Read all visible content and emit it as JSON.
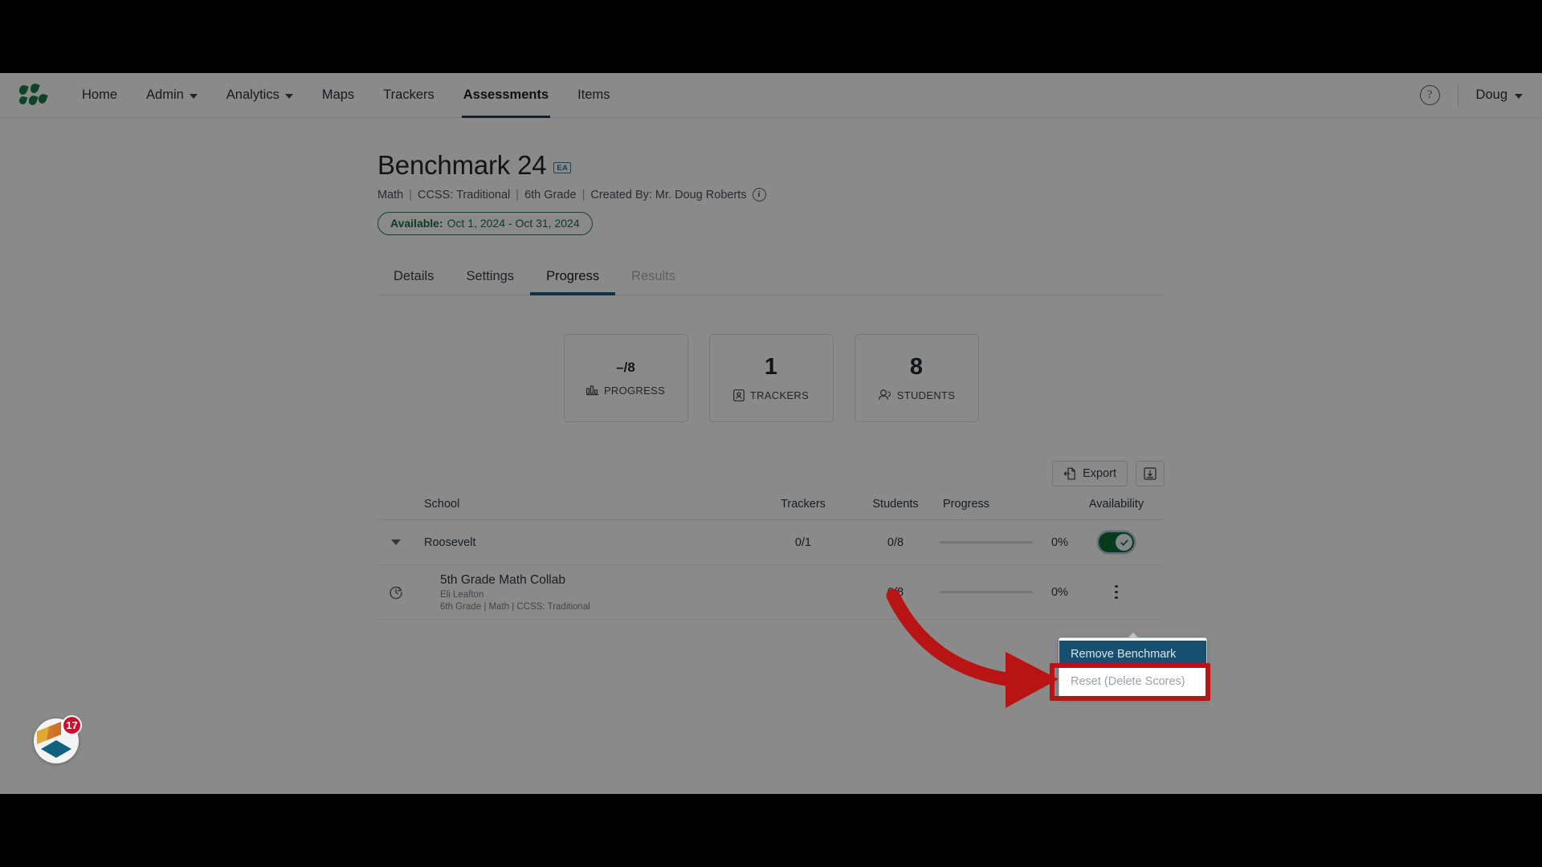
{
  "nav": {
    "logo_icon": "illuminate-leaf-logo",
    "links": [
      {
        "label": "Home",
        "has_caret": false,
        "active": false
      },
      {
        "label": "Admin",
        "has_caret": true,
        "active": false
      },
      {
        "label": "Analytics",
        "has_caret": true,
        "active": false
      },
      {
        "label": "Maps",
        "has_caret": false,
        "active": false
      },
      {
        "label": "Trackers",
        "has_caret": false,
        "active": false
      },
      {
        "label": "Assessments",
        "has_caret": false,
        "active": true
      },
      {
        "label": "Items",
        "has_caret": false,
        "active": false
      }
    ],
    "help_icon": "question-mark-icon",
    "user": "Doug"
  },
  "header": {
    "title": "Benchmark 24",
    "badge": "EA",
    "meta": {
      "subject": "Math",
      "standard": "CCSS: Traditional",
      "grade": "6th Grade",
      "creator": "Created By: Mr. Doug Roberts",
      "info_icon": "info-icon"
    },
    "availability": {
      "label": "Available:",
      "range": "Oct 1, 2024 - Oct 31, 2024",
      "color": "#2f7d52"
    }
  },
  "tabs": [
    {
      "label": "Details",
      "state": "normal"
    },
    {
      "label": "Settings",
      "state": "normal"
    },
    {
      "label": "Progress",
      "state": "active"
    },
    {
      "label": "Results",
      "state": "disabled"
    }
  ],
  "stats": [
    {
      "value": "–/8",
      "label": "PROGRESS",
      "icon": "bar-chart-icon",
      "small": true
    },
    {
      "value": "1",
      "label": "TRACKERS",
      "icon": "tracker-icon",
      "small": false
    },
    {
      "value": "8",
      "label": "STUDENTS",
      "icon": "students-icon",
      "small": false
    }
  ],
  "toolbar": {
    "export_label": "Export",
    "export_icon": "export-icon",
    "download_icon": "download-box-icon"
  },
  "table": {
    "columns": [
      "School",
      "Trackers",
      "Students",
      "Progress",
      "Availability"
    ],
    "rows": [
      {
        "type": "school",
        "name": "Roosevelt",
        "trackers": "0/1",
        "students": "0/8",
        "progress_pct": "0%",
        "progress_value": 0,
        "availability_on": true,
        "expand_icon": "chevron-down-icon",
        "toggle_icon": "check-icon"
      },
      {
        "type": "tracker",
        "name": "5th Grade Math Collab",
        "teacher": "Eli Leafton",
        "details": "6th Grade  |  Math  |  CCSS: Traditional",
        "trackers": "",
        "students": "0/8",
        "progress_pct": "0%",
        "progress_value": 0,
        "row_icon": "reload-clock-icon",
        "menu_icon": "kebab-menu-icon"
      }
    ]
  },
  "menu": {
    "items": [
      {
        "label": "Remove Benchmark",
        "state": "highlighted"
      },
      {
        "label": "Reset (Delete Scores)",
        "state": "dimmed"
      }
    ]
  },
  "annotation": {
    "arrow_color": "#b81414",
    "box_color": "#b81414",
    "target": "Reset (Delete Scores)"
  },
  "fab": {
    "badge_count": "17",
    "icon": "diamond-logo-icon"
  }
}
